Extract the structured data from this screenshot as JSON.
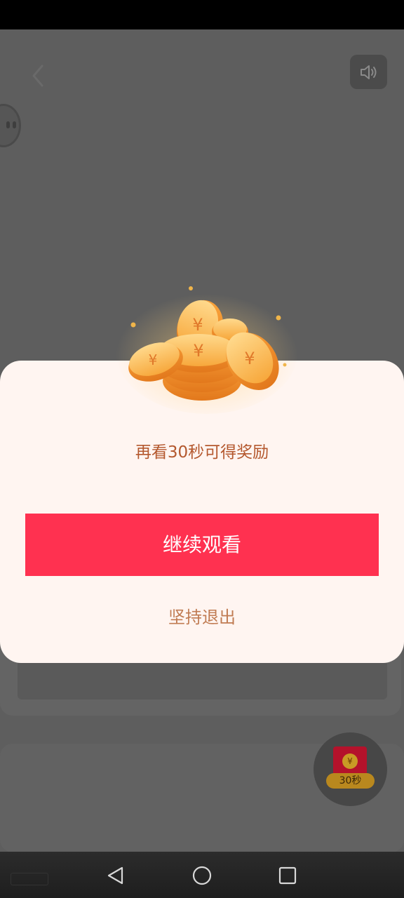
{
  "icons": {
    "back": "chevron-left-icon",
    "sound": "speaker-icon",
    "coins": "coins-icon",
    "redpacket": "red-envelope-icon",
    "nav_back": "triangle-back-icon",
    "nav_home": "circle-home-icon",
    "nav_recents": "square-recents-icon"
  },
  "dialog": {
    "message": "再看30秒可得奖励",
    "continue_label": "继续观看",
    "exit_label": "坚持退出"
  },
  "redpacket": {
    "symbol": "¥",
    "timer": "30秒"
  },
  "colors": {
    "primary": "#ff3150",
    "message_text": "#b4582e",
    "exit_text": "#c07b52",
    "dialog_bg": "#fff5f1",
    "overlay": "#5e5e5e"
  }
}
